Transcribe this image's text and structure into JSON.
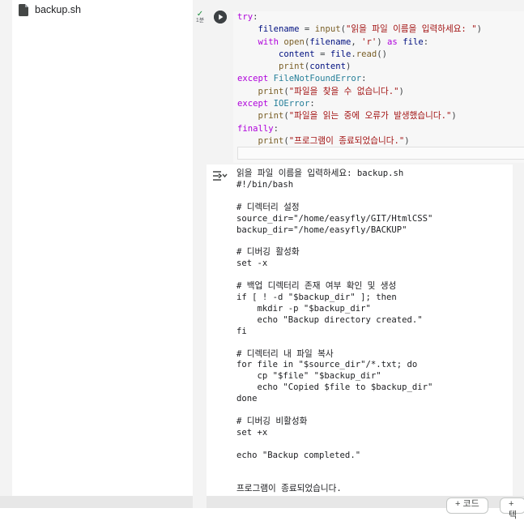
{
  "file_panel": {
    "file_name": "backup.sh"
  },
  "cell": {
    "exec_mark": "✓",
    "exec_time": "1분",
    "run_label": "Run cell"
  },
  "output": {
    "text": "읽을 파일 이름을 입력하세요: backup.sh\n#!/bin/bash\n\n# 디렉터리 설정\nsource_dir=\"/home/easyfly/GIT/HtmlCSS\"\nbackup_dir=\"/home/easyfly/BACKUP\"\n\n# 디버깅 활성화\nset -x\n\n# 백업 디렉터리 존재 여부 확인 및 생성\nif [ ! -d \"$backup_dir\" ]; then\n    mkdir -p \"$backup_dir\"\n    echo \"Backup directory created.\"\nfi\n\n# 디렉터리 내 파일 복사\nfor file in \"$source_dir\"/*.txt; do\n    cp \"$file\" \"$backup_dir\"\n    echo \"Copied $file to $backup_dir\"\ndone\n\n# 디버깅 비활성화\nset +x\n\necho \"Backup completed.\"\n\n\n프로그램이 종료되었습니다."
  },
  "toolbar": {
    "add_code": "+ 코드",
    "add_text": "+ 텍"
  }
}
